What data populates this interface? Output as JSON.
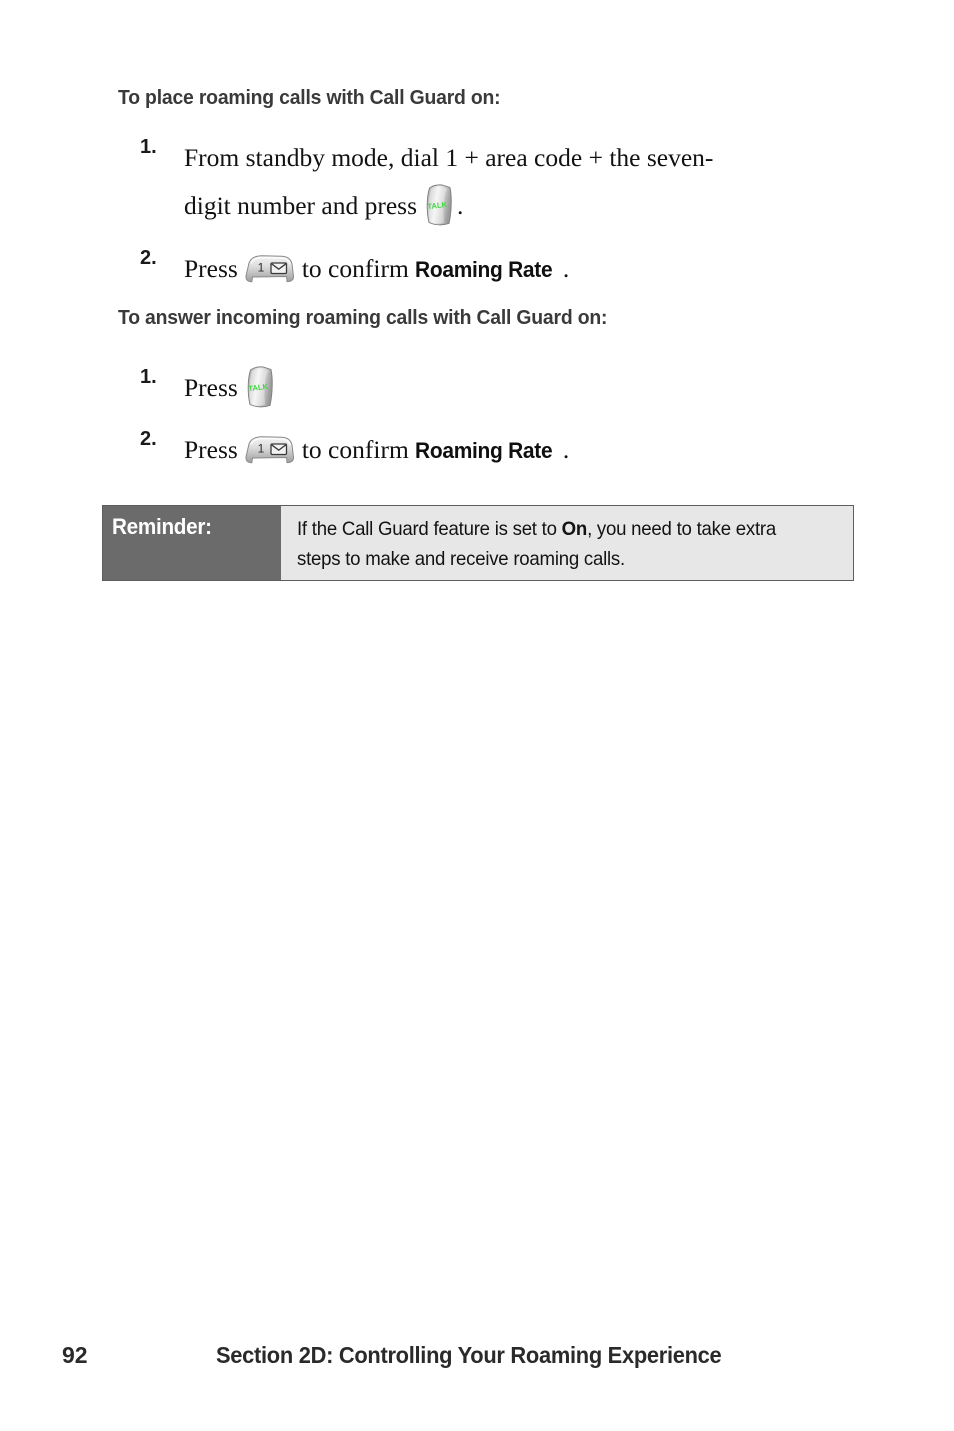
{
  "document": {
    "page_number": "92",
    "section_title": "Section 2D: Controlling Your Roaming Experience"
  },
  "headings": {
    "place_calls": "To place roaming calls with Call Guard on:",
    "answer_calls": "To answer incoming roaming calls with Call Guard on:"
  },
  "place_steps": [
    {
      "number": "1.",
      "text_before_key": "From standby mode, dial 1 + area code + the seven-",
      "wrapped_text_before_key": "digit number and press",
      "key": "talk-key",
      "text_after_key": ".",
      "emphasis": ""
    },
    {
      "number": "2.",
      "text_before_key": "Press",
      "key": "one-key",
      "text_after_key": "to confirm",
      "emphasis": "Roaming Rate",
      "text_end": "."
    }
  ],
  "answer_steps": [
    {
      "number": "1.",
      "text_before_key": "Press",
      "key": "talk-key",
      "text_after_key": "",
      "emphasis": "",
      "text_end": ""
    },
    {
      "number": "2.",
      "text_before_key": "Press",
      "key": "one-key",
      "text_after_key": "to confirm",
      "emphasis": "Roaming Rate",
      "text_end": "."
    }
  ],
  "reminder": {
    "label": "Reminder:",
    "body_part1": "If the Call Guard feature is set to ",
    "body_bold": "On",
    "body_part2": ", you need to take extra steps to make and receive roaming calls."
  },
  "keys": {
    "talk_label": "TALK",
    "one_label": "1",
    "one_envelope": "envelope-icon"
  },
  "colors": {
    "reminder_label_bg": "#6b6b6b",
    "reminder_body_bg": "#e7e7e7",
    "reminder_border": "#5d5d5d",
    "talk_text": "#3fd63f",
    "heading_text": "#3a3a3a",
    "body_text": "#121212",
    "page_bg": "#ffffff"
  }
}
